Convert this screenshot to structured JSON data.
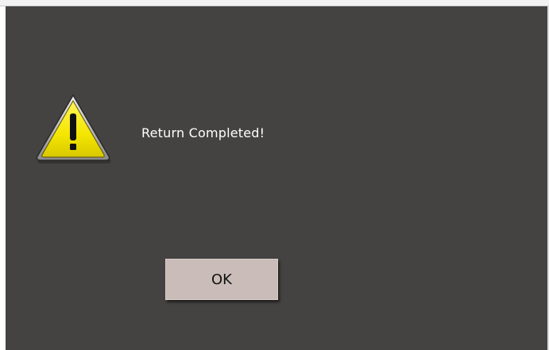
{
  "dialog": {
    "message": "Return Completed!",
    "ok_label": "OK",
    "icon": "warning-icon",
    "colors": {
      "background": "#454341",
      "button": "#cabdb9",
      "warning_yellow": "#f4e600"
    }
  }
}
